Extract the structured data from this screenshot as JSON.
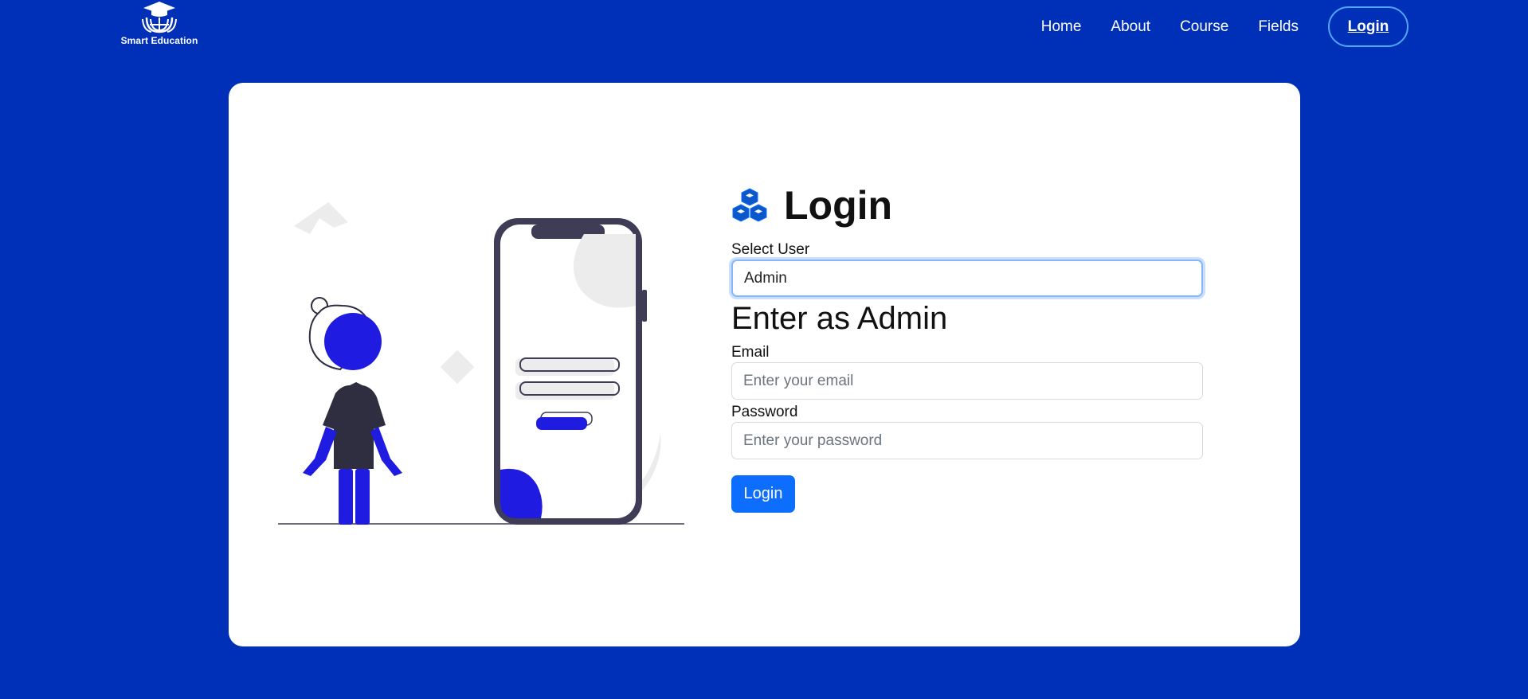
{
  "header": {
    "logo_text": "Smart Education",
    "nav": [
      {
        "label": "Home"
      },
      {
        "label": "About"
      },
      {
        "label": "Course"
      },
      {
        "label": "Fields"
      }
    ],
    "login_label": "Login"
  },
  "form": {
    "icon": "cubes-icon",
    "title": "Login",
    "select_label": "Select User",
    "select_value": "Admin",
    "subheading": "Enter as Admin",
    "email_label": "Email",
    "email_placeholder": "Enter your email",
    "password_label": "Password",
    "password_placeholder": "Enter your password",
    "submit_label": "Login"
  },
  "colors": {
    "background": "#0030b8",
    "accent": "#0d6efd",
    "illustration_accent": "#1f1be0"
  }
}
